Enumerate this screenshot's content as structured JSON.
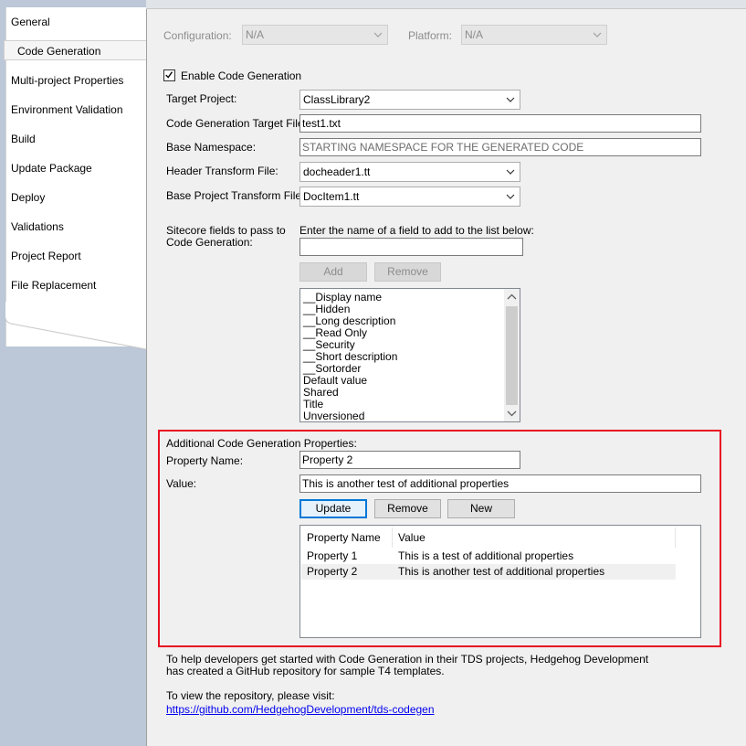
{
  "sidebar": {
    "items": [
      {
        "label": "General"
      },
      {
        "label": "Code Generation"
      },
      {
        "label": "Multi-project Properties"
      },
      {
        "label": "Environment Validation"
      },
      {
        "label": "Build"
      },
      {
        "label": "Update Package"
      },
      {
        "label": "Deploy"
      },
      {
        "label": "Validations"
      },
      {
        "label": "Project Report"
      },
      {
        "label": "File Replacement"
      }
    ],
    "selected": "Code Generation"
  },
  "config_bar": {
    "configuration_label": "Configuration:",
    "configuration_value": "N/A",
    "platform_label": "Platform:",
    "platform_value": "N/A"
  },
  "form": {
    "enable_label": "Enable Code Generation",
    "enable_checked": true,
    "target_project_label": "Target Project:",
    "target_project_value": "ClassLibrary2",
    "target_file_label": "Code Generation Target File:",
    "target_file_value": "test1.txt",
    "base_namespace_label": "Base Namespace:",
    "base_namespace_placeholder": "STARTING NAMESPACE FOR THE GENERATED CODE",
    "header_transform_label": "Header Transform File:",
    "header_transform_value": "docheader1.tt",
    "base_project_transform_label": "Base Project Transform File:",
    "base_project_transform_value": "DocItem1.tt"
  },
  "fields": {
    "label_line1": "Sitecore fields to pass to",
    "label_line2": "Code Generation:",
    "instruction": "Enter the name of a field to add to the list below:",
    "input_value": "",
    "add_label": "Add",
    "remove_label": "Remove",
    "items": [
      "__Display name",
      "__Hidden",
      "__Long description",
      "__Read Only",
      "__Security",
      "__Short description",
      "__Sortorder",
      "Default value",
      "Shared",
      "Title",
      "Unversioned"
    ]
  },
  "additional": {
    "heading": "Additional Code Generation Properties:",
    "property_name_label": "Property Name:",
    "property_name_value": "Property 2",
    "value_label": "Value:",
    "value_value": "This is another test of additional properties",
    "update_label": "Update",
    "remove_label": "Remove",
    "new_label": "New",
    "columns": [
      "Property Name",
      "Value"
    ],
    "rows": [
      {
        "name": "Property 1",
        "value": "This is a test of additional properties"
      },
      {
        "name": "Property 2",
        "value": "This is another test of additional properties"
      }
    ],
    "selected_row": "Property 2",
    "highlight_color": "#e81123"
  },
  "footer": {
    "info_line1": "To help developers get started with Code Generation in their TDS projects, Hedgehog Development",
    "info_line2": "has created a GitHub repository for sample T4 templates.",
    "visit_text": "To view the repository, please visit:",
    "link_text": "https://github.com/HedgehogDevelopment/tds-codegen"
  }
}
